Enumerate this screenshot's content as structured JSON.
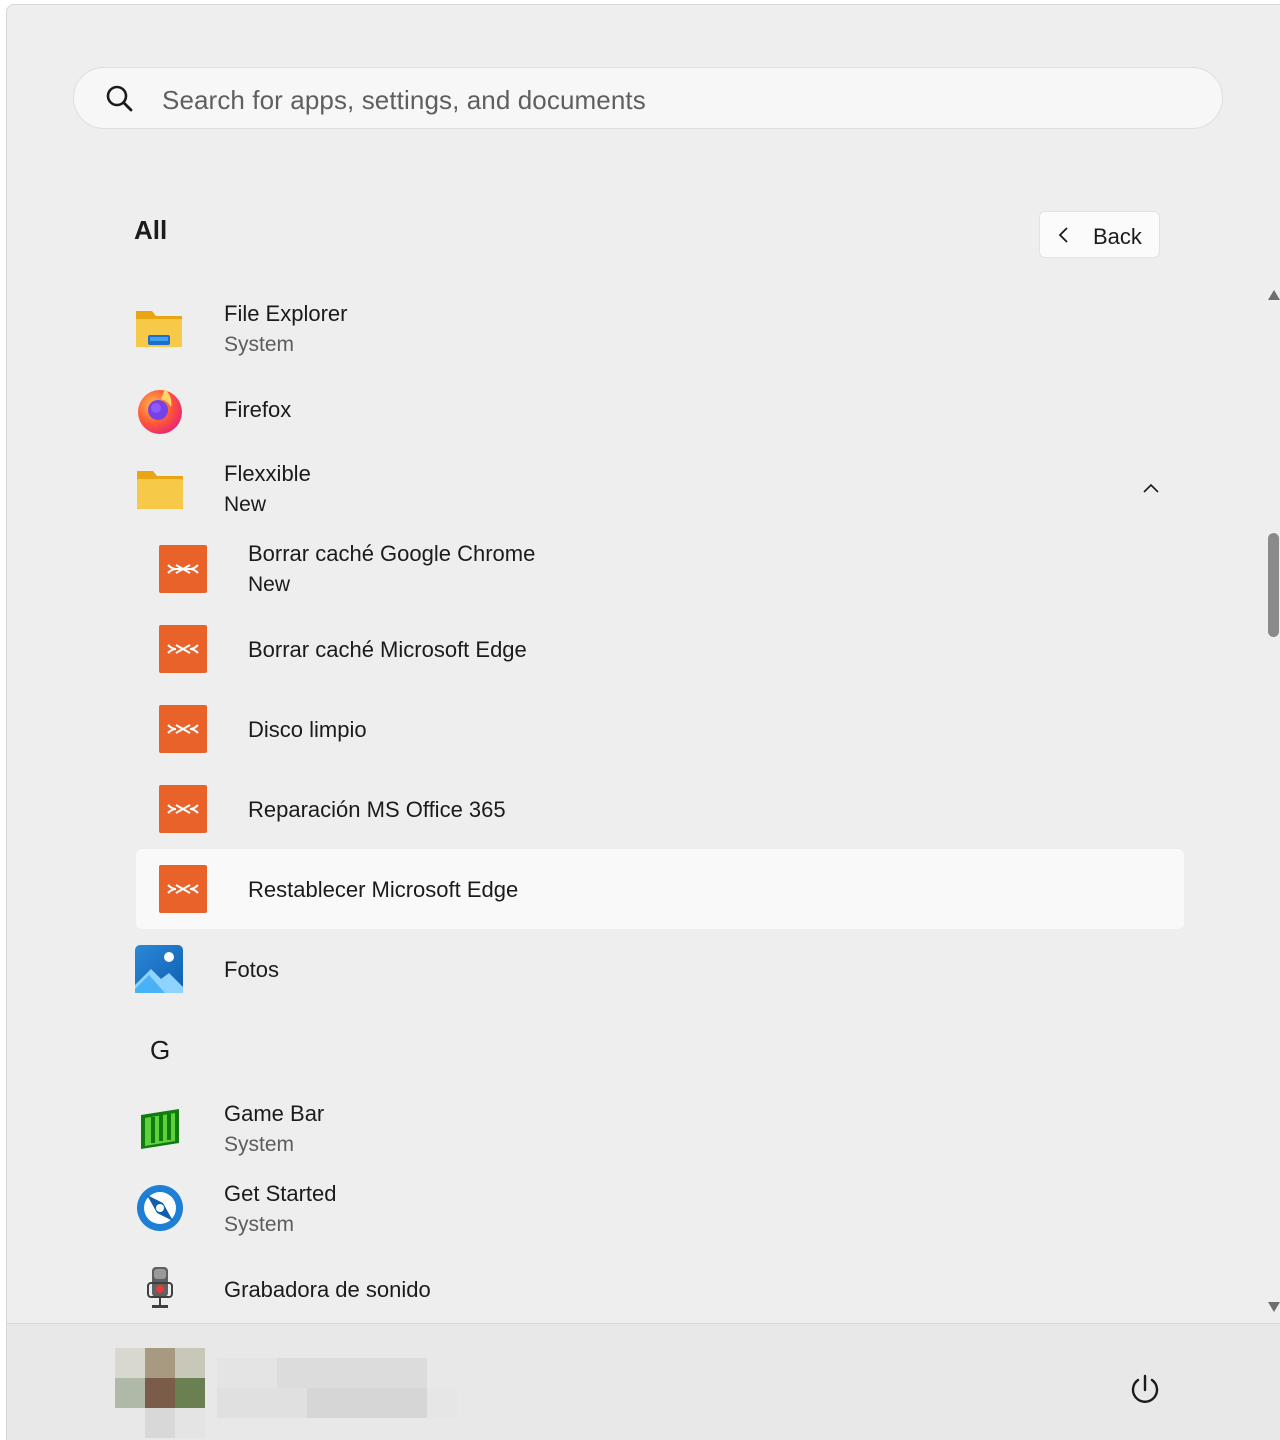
{
  "search": {
    "placeholder": "Search for apps, settings, and documents"
  },
  "header": {
    "title": "All",
    "back_label": "Back"
  },
  "apps": [
    {
      "name": "File Explorer",
      "subtitle": "System",
      "icon": "file-explorer-icon"
    },
    {
      "name": "Firefox",
      "icon": "firefox-icon"
    },
    {
      "name": "Flexxible",
      "subtitle": "New",
      "icon": "folder-icon",
      "expanded": true
    },
    {
      "name": "Borrar caché Google Chrome",
      "subtitle": "New",
      "icon": "flexxible-app-icon"
    },
    {
      "name": "Borrar caché Microsoft Edge",
      "icon": "flexxible-app-icon"
    },
    {
      "name": "Disco limpio",
      "icon": "flexxible-app-icon"
    },
    {
      "name": "Reparación MS Office 365",
      "icon": "flexxible-app-icon"
    },
    {
      "name": "Restablecer Microsoft Edge",
      "icon": "flexxible-app-icon",
      "hovered": true
    },
    {
      "name": "Fotos",
      "icon": "photos-icon"
    },
    {
      "name": "Game Bar",
      "subtitle": "System",
      "icon": "game-bar-icon"
    },
    {
      "name": "Get Started",
      "subtitle": "System",
      "icon": "get-started-icon"
    },
    {
      "name": "Grabadora de sonido",
      "icon": "sound-recorder-icon"
    }
  ],
  "section_letter": "G",
  "colors": {
    "panel_bg": "#eeeeee",
    "flexxible_orange": "#e8622a",
    "folder_yellow": "#f7c948",
    "hover_bg": "#f9f9f9"
  }
}
